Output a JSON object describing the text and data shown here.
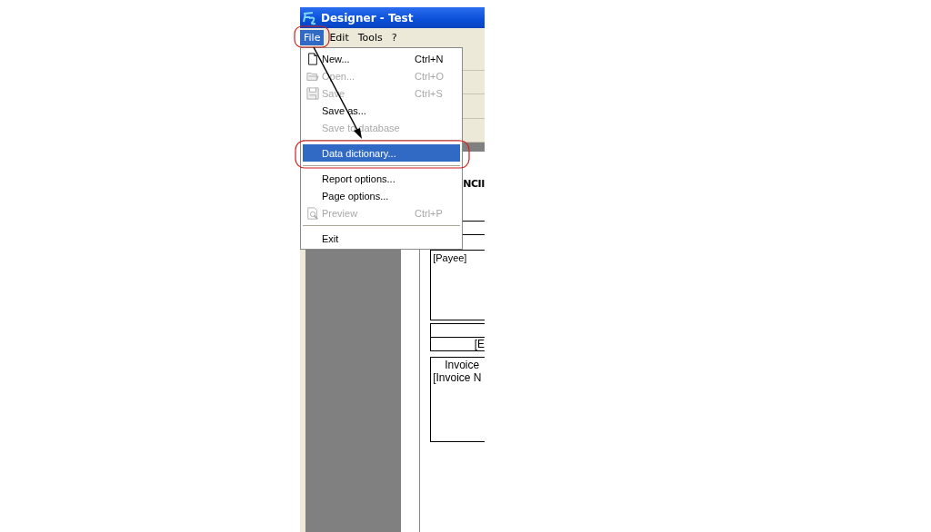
{
  "window": {
    "title": "Designer - Test"
  },
  "menu_bar": [
    {
      "label": "File",
      "selected": true
    },
    {
      "label": "Edit",
      "selected": false
    },
    {
      "label": "Tools",
      "selected": false
    },
    {
      "label": "?",
      "selected": false
    }
  ],
  "file_menu": [
    {
      "kind": "item",
      "label": "New...",
      "shortcut": "Ctrl+N",
      "disabled": false,
      "selected": false
    },
    {
      "kind": "item",
      "label": "Open...",
      "shortcut": "Ctrl+O",
      "disabled": true,
      "selected": false
    },
    {
      "kind": "item",
      "label": "Save",
      "shortcut": "Ctrl+S",
      "disabled": true,
      "selected": false
    },
    {
      "kind": "item",
      "label": "Save as...",
      "disabled": false,
      "selected": false
    },
    {
      "kind": "item",
      "label": "Save to database",
      "disabled": true,
      "selected": false
    },
    {
      "kind": "separator"
    },
    {
      "kind": "item",
      "label": "Data dictionary...",
      "disabled": false,
      "selected": true
    },
    {
      "kind": "separator"
    },
    {
      "kind": "item",
      "label": "Report options...",
      "disabled": false,
      "selected": false
    },
    {
      "kind": "item",
      "label": "Page options...",
      "disabled": false,
      "selected": false
    },
    {
      "kind": "item",
      "label": "Preview",
      "shortcut": "Ctrl+P",
      "disabled": true,
      "selected": false
    },
    {
      "kind": "separator"
    },
    {
      "kind": "item",
      "label": "Exit",
      "disabled": false,
      "selected": false
    }
  ],
  "document": {
    "heading": "NCII",
    "payee": "[Payee]",
    "box_text": "[E",
    "invoice_label": "Invoice",
    "invoice_number": "[Invoice N"
  }
}
